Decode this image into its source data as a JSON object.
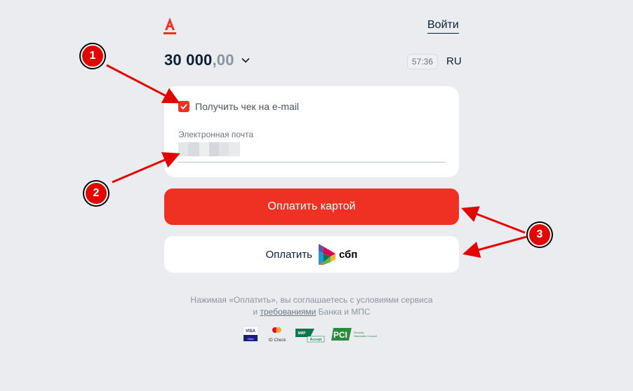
{
  "header": {
    "logo": "А",
    "login_label": "Войти"
  },
  "amount": {
    "main": "30 000",
    "cents": ",00"
  },
  "timer": "57:36",
  "language": "RU",
  "form": {
    "checkbox_label": "Получить чек на e-mail",
    "email_label": "Электронная почта"
  },
  "buttons": {
    "pay_card": "Оплатить картой",
    "pay_sbp": "Оплатить",
    "sbp_brand": "сбп"
  },
  "terms": {
    "line1": "Нажимая «Оплатить», вы соглашаетесь с условиями сервиса",
    "line2_prefix": "и ",
    "line2_link": "требованиями",
    "line2_suffix": " Банка и МПС"
  },
  "badges": {
    "visa_top": "VISA",
    "visa_bottom": "Click",
    "mc_label": "ID Check",
    "mir_top": "МИР",
    "mir_bottom": "Accept",
    "pci_label": "PCI",
    "pci_text_1": "Security",
    "pci_text_2": "Standards Council"
  },
  "annotations": {
    "marker_1": "1",
    "marker_2": "2",
    "marker_3": "3"
  },
  "colors": {
    "brand_red": "#ef3124",
    "background": "#eaecef",
    "marker_red": "#e10600"
  }
}
